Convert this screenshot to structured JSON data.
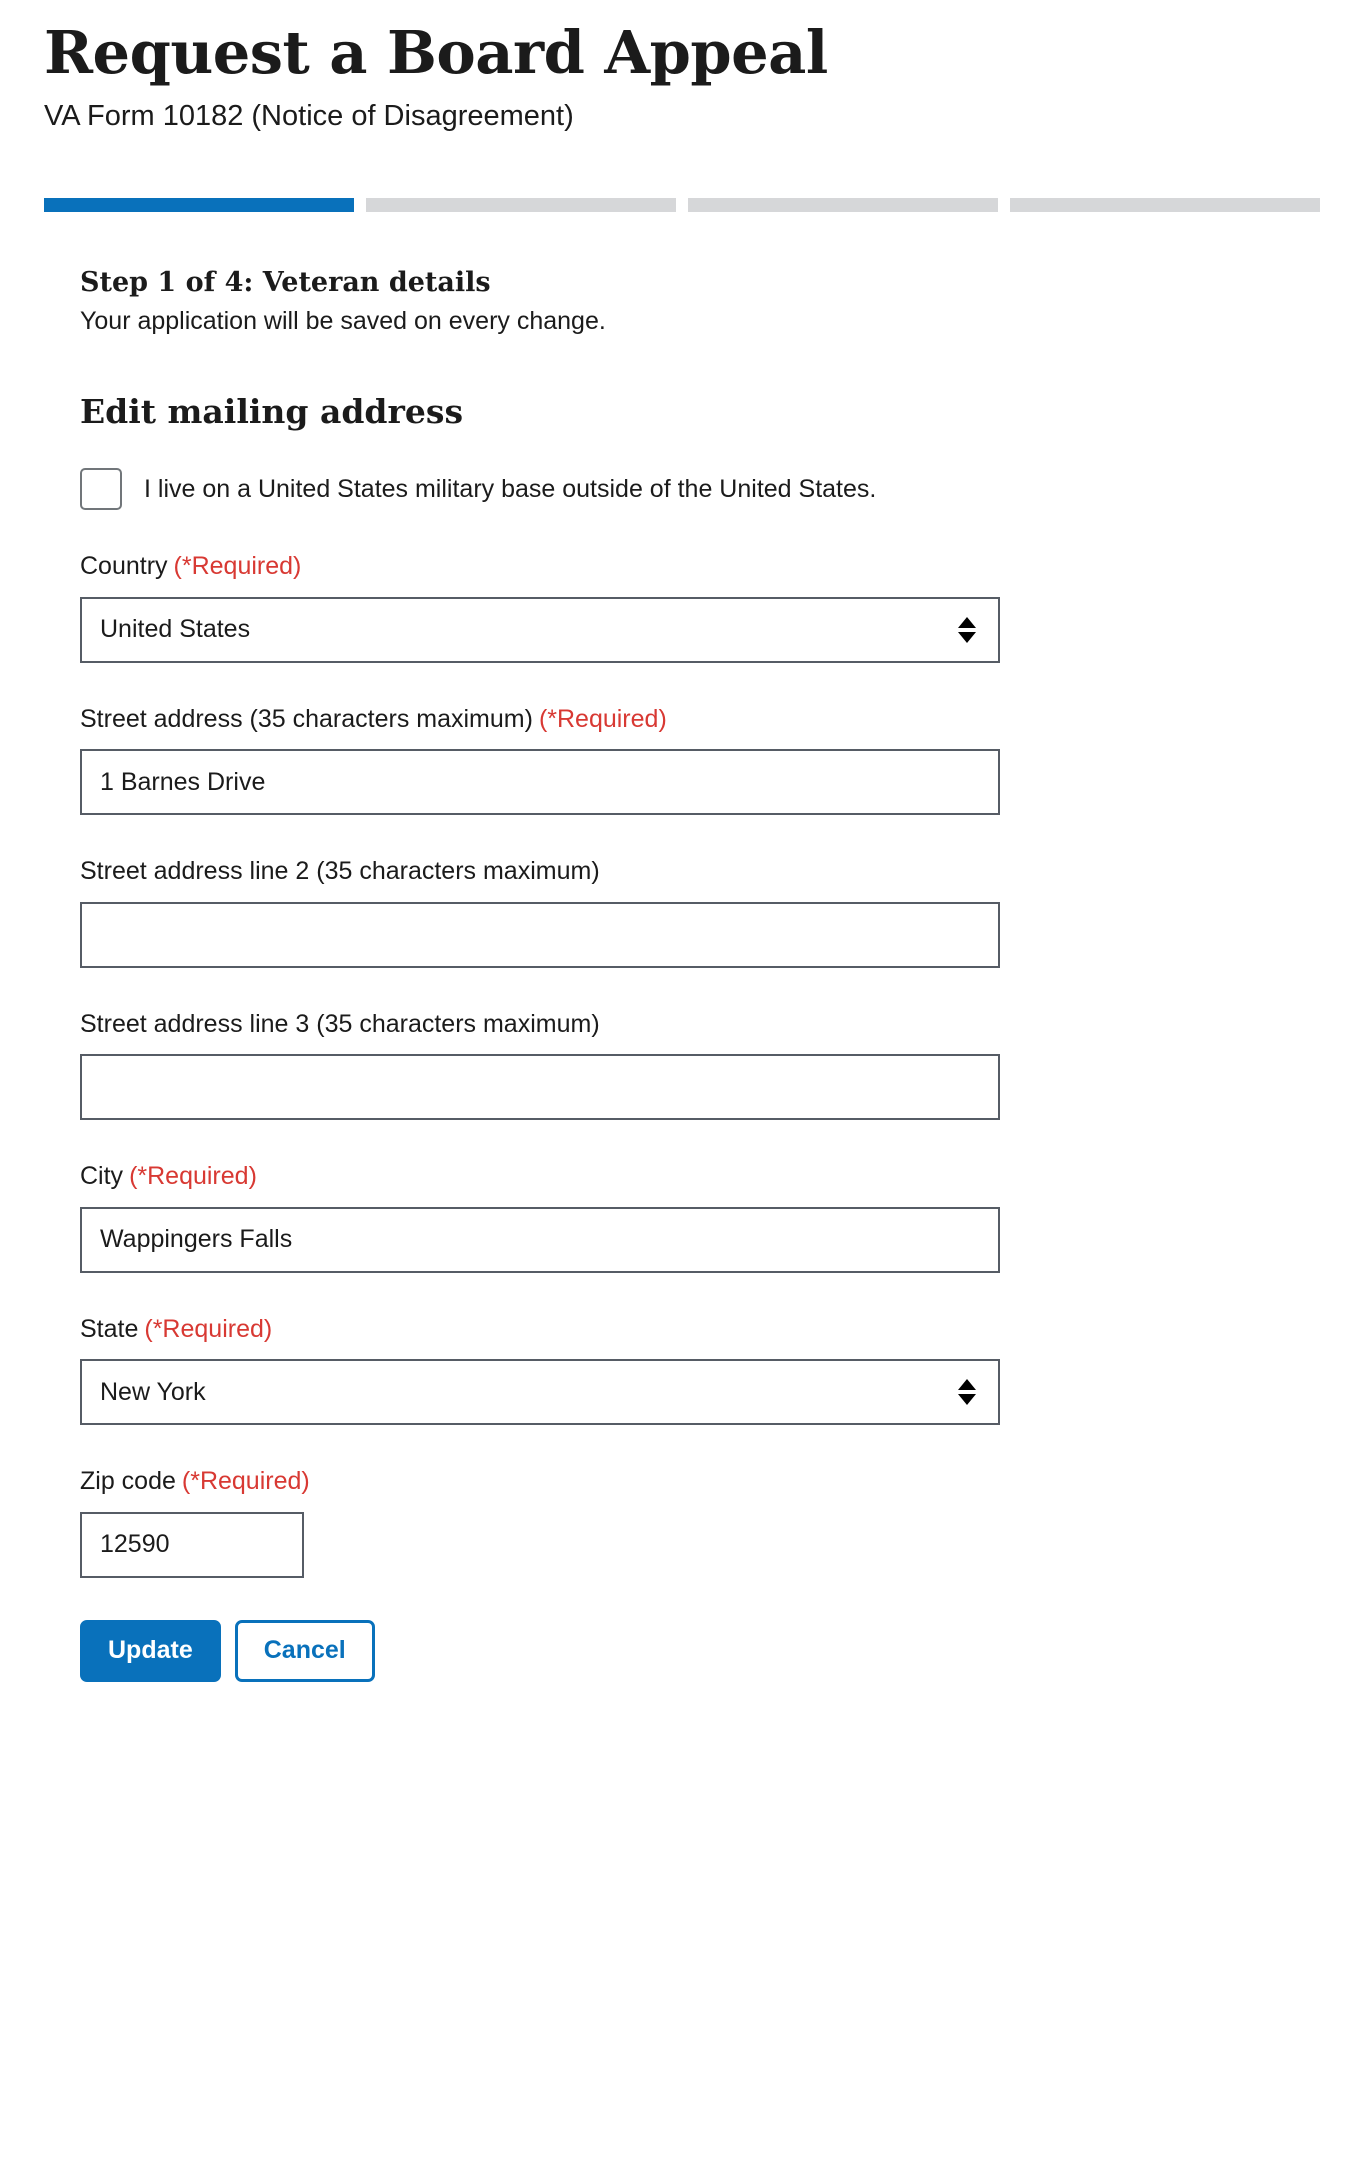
{
  "header": {
    "title": "Request a Board Appeal",
    "subtitle": "VA Form 10182 (Notice of Disagreement)"
  },
  "progress": {
    "total_steps": 4,
    "current_step": 1,
    "active_color": "#0971bb",
    "inactive_color": "#d6d7d9"
  },
  "step": {
    "heading": "Step 1 of 4: Veteran details",
    "subtext": "Your application will be saved on every change."
  },
  "section": {
    "heading": "Edit mailing address"
  },
  "military_base_checkbox": {
    "label": "I live on a United States military base outside of the United States.",
    "checked": false
  },
  "required_tag": "(*Required)",
  "fields": {
    "country": {
      "label": "Country",
      "required_tag": "(*Required)",
      "value": "United States",
      "type": "select"
    },
    "street1": {
      "label": "Street address (35 characters maximum)",
      "required_tag": "(*Required)",
      "value": "1 Barnes Drive",
      "type": "text"
    },
    "street2": {
      "label": "Street address line 2 (35 characters maximum)",
      "required_tag": "",
      "value": "",
      "type": "text"
    },
    "street3": {
      "label": "Street address line 3 (35 characters maximum)",
      "required_tag": "",
      "value": "",
      "type": "text"
    },
    "city": {
      "label": "City",
      "required_tag": "(*Required)",
      "value": "Wappingers Falls",
      "type": "text"
    },
    "state": {
      "label": "State",
      "required_tag": "(*Required)",
      "value": "New York",
      "type": "select"
    },
    "zip": {
      "label": "Zip code",
      "required_tag": "(*Required)",
      "value": "12590",
      "type": "text"
    }
  },
  "buttons": {
    "update": "Update",
    "cancel": "Cancel"
  },
  "colors": {
    "accent_blue": "#0971bb",
    "required_red": "#d83933",
    "input_border": "#565c65",
    "checkbox_border": "#71767a"
  }
}
